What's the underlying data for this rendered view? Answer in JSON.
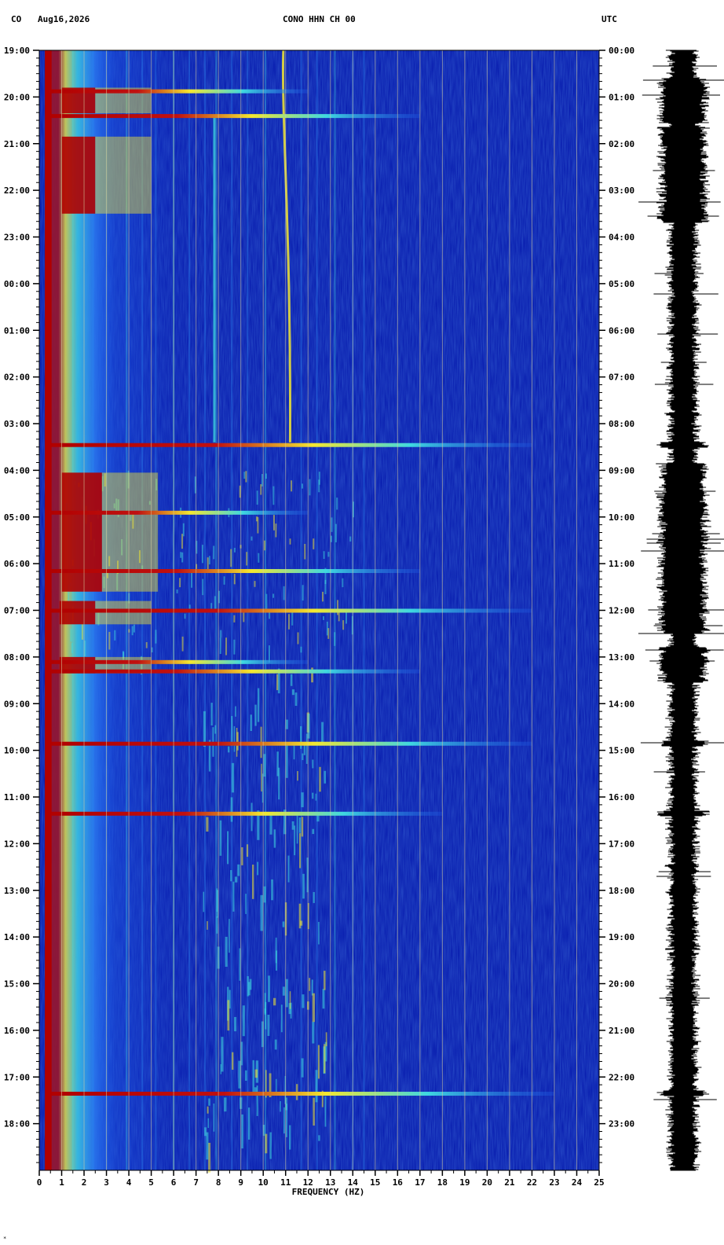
{
  "header": {
    "network": "CO",
    "date": "Aug16,2026",
    "channel": "CONO HHN CH 00",
    "timezone": "UTC"
  },
  "corner_mark": "*",
  "chart_data": {
    "type": "heatmap",
    "title": "CONO HHN CH 00",
    "xlabel": "FREQUENCY (HZ)",
    "ylabel": "",
    "xlim": [
      0,
      25
    ],
    "x_ticks": [
      "0",
      "1",
      "2",
      "3",
      "4",
      "5",
      "6",
      "7",
      "8",
      "9",
      "10",
      "11",
      "12",
      "13",
      "14",
      "15",
      "16",
      "17",
      "18",
      "19",
      "20",
      "21",
      "22",
      "23",
      "24",
      "25"
    ],
    "y_left_ticks": [
      "19:00",
      "20:00",
      "21:00",
      "22:00",
      "23:00",
      "00:00",
      "01:00",
      "02:00",
      "03:00",
      "04:00",
      "05:00",
      "06:00",
      "07:00",
      "08:00",
      "09:00",
      "10:00",
      "11:00",
      "12:00",
      "13:00",
      "14:00",
      "15:00",
      "16:00",
      "17:00",
      "18:00"
    ],
    "y_right_ticks": [
      "00:00",
      "01:00",
      "02:00",
      "03:00",
      "04:00",
      "05:00",
      "06:00",
      "07:00",
      "08:00",
      "09:00",
      "10:00",
      "11:00",
      "12:00",
      "13:00",
      "14:00",
      "15:00",
      "16:00",
      "17:00",
      "18:00",
      "19:00",
      "20:00",
      "21:00",
      "22:00",
      "23:00"
    ],
    "hours_span": 24,
    "colors": {
      "background": "#0a1fb0",
      "mid": "#1f5de8",
      "cyan": "#3fd8e0",
      "yellow": "#f4e830",
      "red": "#b00000",
      "gridline": "#d8d0a0"
    },
    "broadband_events_hours": [
      0.87,
      1.4,
      8.45,
      9.9,
      11.15,
      12.0,
      13.1,
      13.3,
      14.85,
      16.35,
      22.35
    ],
    "saturated_blocks": [
      {
        "f0": 1.0,
        "f1": 2.5,
        "h0": 0.8,
        "h1": 1.35
      },
      {
        "f0": 1.0,
        "f1": 2.5,
        "h0": 1.85,
        "h1": 3.5
      },
      {
        "f0": 1.0,
        "f1": 2.8,
        "h0": 9.05,
        "h1": 11.6
      },
      {
        "f0": 0.9,
        "f1": 2.5,
        "h0": 11.8,
        "h1": 12.3
      },
      {
        "f0": 0.9,
        "f1": 2.5,
        "h0": 13.0,
        "h1": 13.35
      }
    ],
    "drifting_line": {
      "label": "",
      "f_start": 10.9,
      "f_end": 11.2,
      "h0": 0.0,
      "h1": 8.4
    },
    "seismogram_amplitude": "relative trace, 24 h"
  }
}
